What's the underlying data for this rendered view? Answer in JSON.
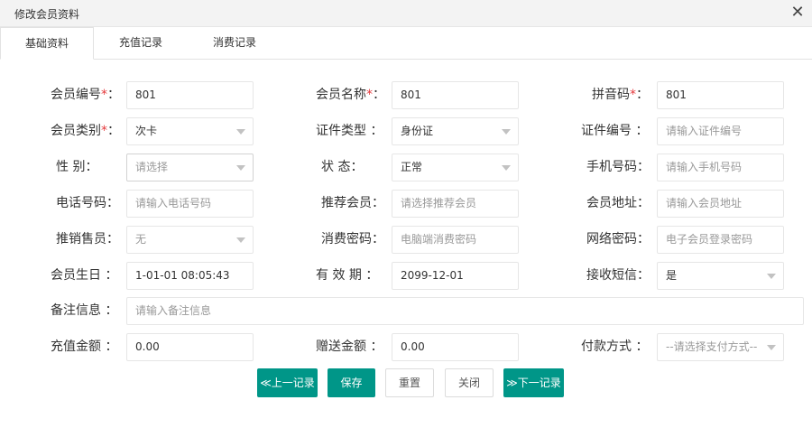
{
  "dialog": {
    "title": "修改会员资料",
    "close_glyph": "✕"
  },
  "tabs": [
    "基础资料",
    "充值记录",
    "消费记录"
  ],
  "form": {
    "member_no": {
      "label": "会员编号",
      "value": "801"
    },
    "member_name": {
      "label": "会员名称",
      "value": "801"
    },
    "pinyin": {
      "label": "拼音码",
      "value": "801"
    },
    "member_type": {
      "label": "会员类别",
      "value": "次卡"
    },
    "id_type": {
      "label": "证件类型  ：",
      "value": "身份证"
    },
    "id_no": {
      "label": "证件编号  ：",
      "placeholder": "请输入证件编号"
    },
    "gender": {
      "label": "性   别：",
      "placeholder": "请选择"
    },
    "status": {
      "label": "状   态：",
      "value": "正常"
    },
    "mobile": {
      "label": "手机号码：",
      "placeholder": "请输入手机号码"
    },
    "phone": {
      "label": "电话号码：",
      "placeholder": "请输入电话号码"
    },
    "referrer": {
      "label": "推荐会员：",
      "placeholder": "请选择推荐会员"
    },
    "address": {
      "label": "会员地址：",
      "placeholder": "请输入会员地址"
    },
    "salesperson": {
      "label": "推销售员：",
      "value": "无"
    },
    "pay_password": {
      "label": "消费密码：",
      "placeholder": "电脑端消费密码"
    },
    "web_password": {
      "label": "网络密码：",
      "placeholder": "电子会员登录密码"
    },
    "birthday": {
      "label": "会员生日  ：",
      "value": "1-01-01 08:05:43"
    },
    "valid_until": {
      "label": "有 效 期  ：",
      "value": "2099-12-01"
    },
    "sms": {
      "label": "接收短信：",
      "value": "是"
    },
    "remark": {
      "label": "备注信息  ：",
      "placeholder": "请输入备注信息"
    },
    "recharge": {
      "label": "充值金额  ：",
      "value": "0.00"
    },
    "bonus": {
      "label": "赠送金额  ：",
      "value": "0.00"
    },
    "payment": {
      "label": "付款方式  ：",
      "placeholder": "--请选择支付方式--"
    }
  },
  "required_mark": "*",
  "colon": "：",
  "buttons": {
    "prev": "≪上一记录",
    "save": "保存",
    "reset": "重置",
    "close": "关闭",
    "next": "≫下一记录"
  },
  "colors": {
    "primary": "#009688",
    "required": "#e4393c"
  }
}
